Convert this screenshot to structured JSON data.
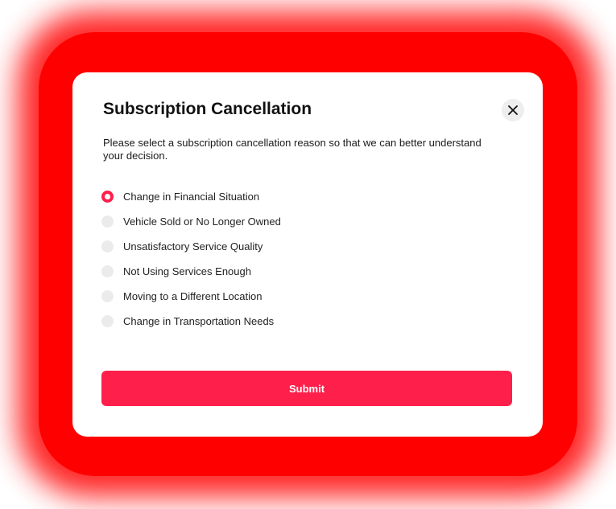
{
  "modal": {
    "title": "Subscription Cancellation",
    "close_icon": "close-icon",
    "description": "Please select a subscription cancellation reason so that we can better understand your decision.",
    "reasons": [
      {
        "label": "Change in Financial Situation",
        "selected": true
      },
      {
        "label": "Vehicle Sold or No Longer Owned",
        "selected": false
      },
      {
        "label": "Unsatisfactory Service Quality",
        "selected": false
      },
      {
        "label": "Not Using Services Enough",
        "selected": false
      },
      {
        "label": "Moving to a Different Location",
        "selected": false
      },
      {
        "label": "Change in Transportation Needs",
        "selected": false
      }
    ],
    "submit_label": "Submit"
  },
  "colors": {
    "accent": "#ff1f4b",
    "glow": "#ff0000",
    "radio_unselected": "#ebebeb"
  }
}
